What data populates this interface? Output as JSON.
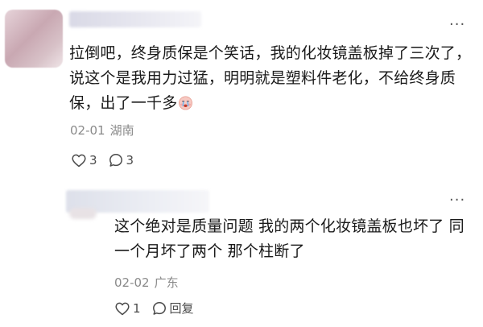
{
  "comment": {
    "text": "拉倒吧，终身质保是个笑话，我的化妆镜盖板掉了三次了，说这个是我用力过猛，明明就是塑料件老化，不给终身质保，出了一千多",
    "emoji": "crying-face-emoji",
    "date": "02-01",
    "location": "湖南",
    "likes": "3",
    "replies": "3"
  },
  "reply": {
    "text": "这个绝对是质量问题 我的两个化妆镜盖板也坏了 同一个月坏了两个 那个柱断了",
    "date": "02-02",
    "location": "广东",
    "likes": "1",
    "reply_label": "回复"
  },
  "more_label": "···",
  "colors": {
    "text": "#1a1a1a",
    "meta": "#8a8a8a",
    "icon": "#4a4a4a",
    "background": "#ffffff"
  }
}
